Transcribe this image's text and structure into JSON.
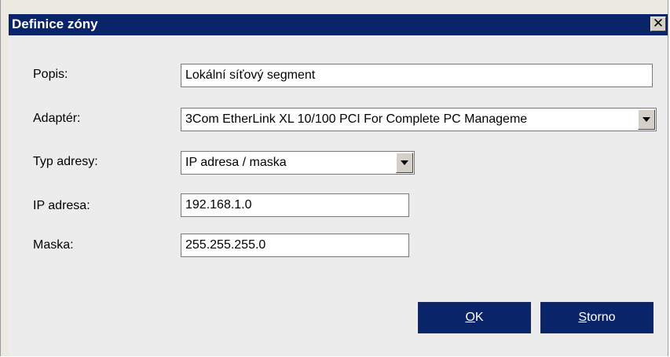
{
  "window": {
    "title": "Definice zóny",
    "close_glyph": "✕"
  },
  "form": {
    "popis_label": "Popis:",
    "popis_value": "Lokální síťový segment",
    "adapter_label": "Adaptér:",
    "adapter_value": "3Com EtherLink XL 10/100 PCI For Complete PC Manageme",
    "typ_label": "Typ adresy:",
    "typ_value": "IP adresa / maska",
    "ip_label": "IP adresa:",
    "ip_value": "192.168.1.0",
    "maska_label": "Maska:",
    "maska_value": "255.255.255.0"
  },
  "buttons": {
    "ok_mnemonic": "O",
    "ok_rest": "K",
    "storno_mnemonic": "S",
    "storno_rest": "torno"
  },
  "colors": {
    "titlebar": "#0a246a",
    "button": "#0a246a",
    "dialog_bg": "#ececec"
  }
}
